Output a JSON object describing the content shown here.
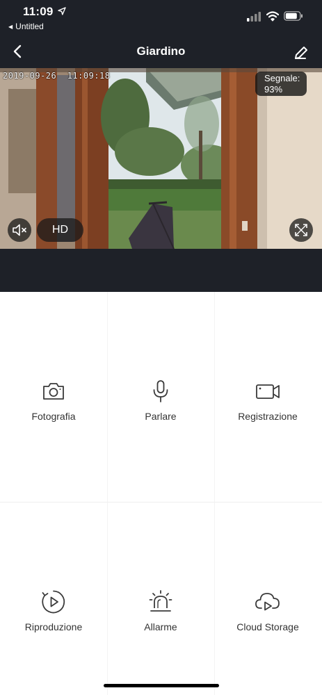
{
  "status_bar": {
    "time": "11:09",
    "back_app_label": "Untitled"
  },
  "nav": {
    "title": "Giardino"
  },
  "feed": {
    "timestamp": "2019-09-26  11:09:18",
    "signal_label": "Segnale:",
    "signal_value": "93%",
    "quality_label": "HD"
  },
  "actions": [
    {
      "label": "Fotografia",
      "icon": "camera-icon"
    },
    {
      "label": "Parlare",
      "icon": "microphone-icon"
    },
    {
      "label": "Registrazione",
      "icon": "video-camera-icon"
    },
    {
      "label": "Riproduzione",
      "icon": "playback-icon"
    },
    {
      "label": "Allarme",
      "icon": "alarm-light-icon"
    },
    {
      "label": "Cloud Storage",
      "icon": "cloud-play-icon"
    }
  ],
  "colors": {
    "header_bg": "#1e2128",
    "icon_stroke": "#3a3a3a",
    "label_text": "#333333"
  }
}
